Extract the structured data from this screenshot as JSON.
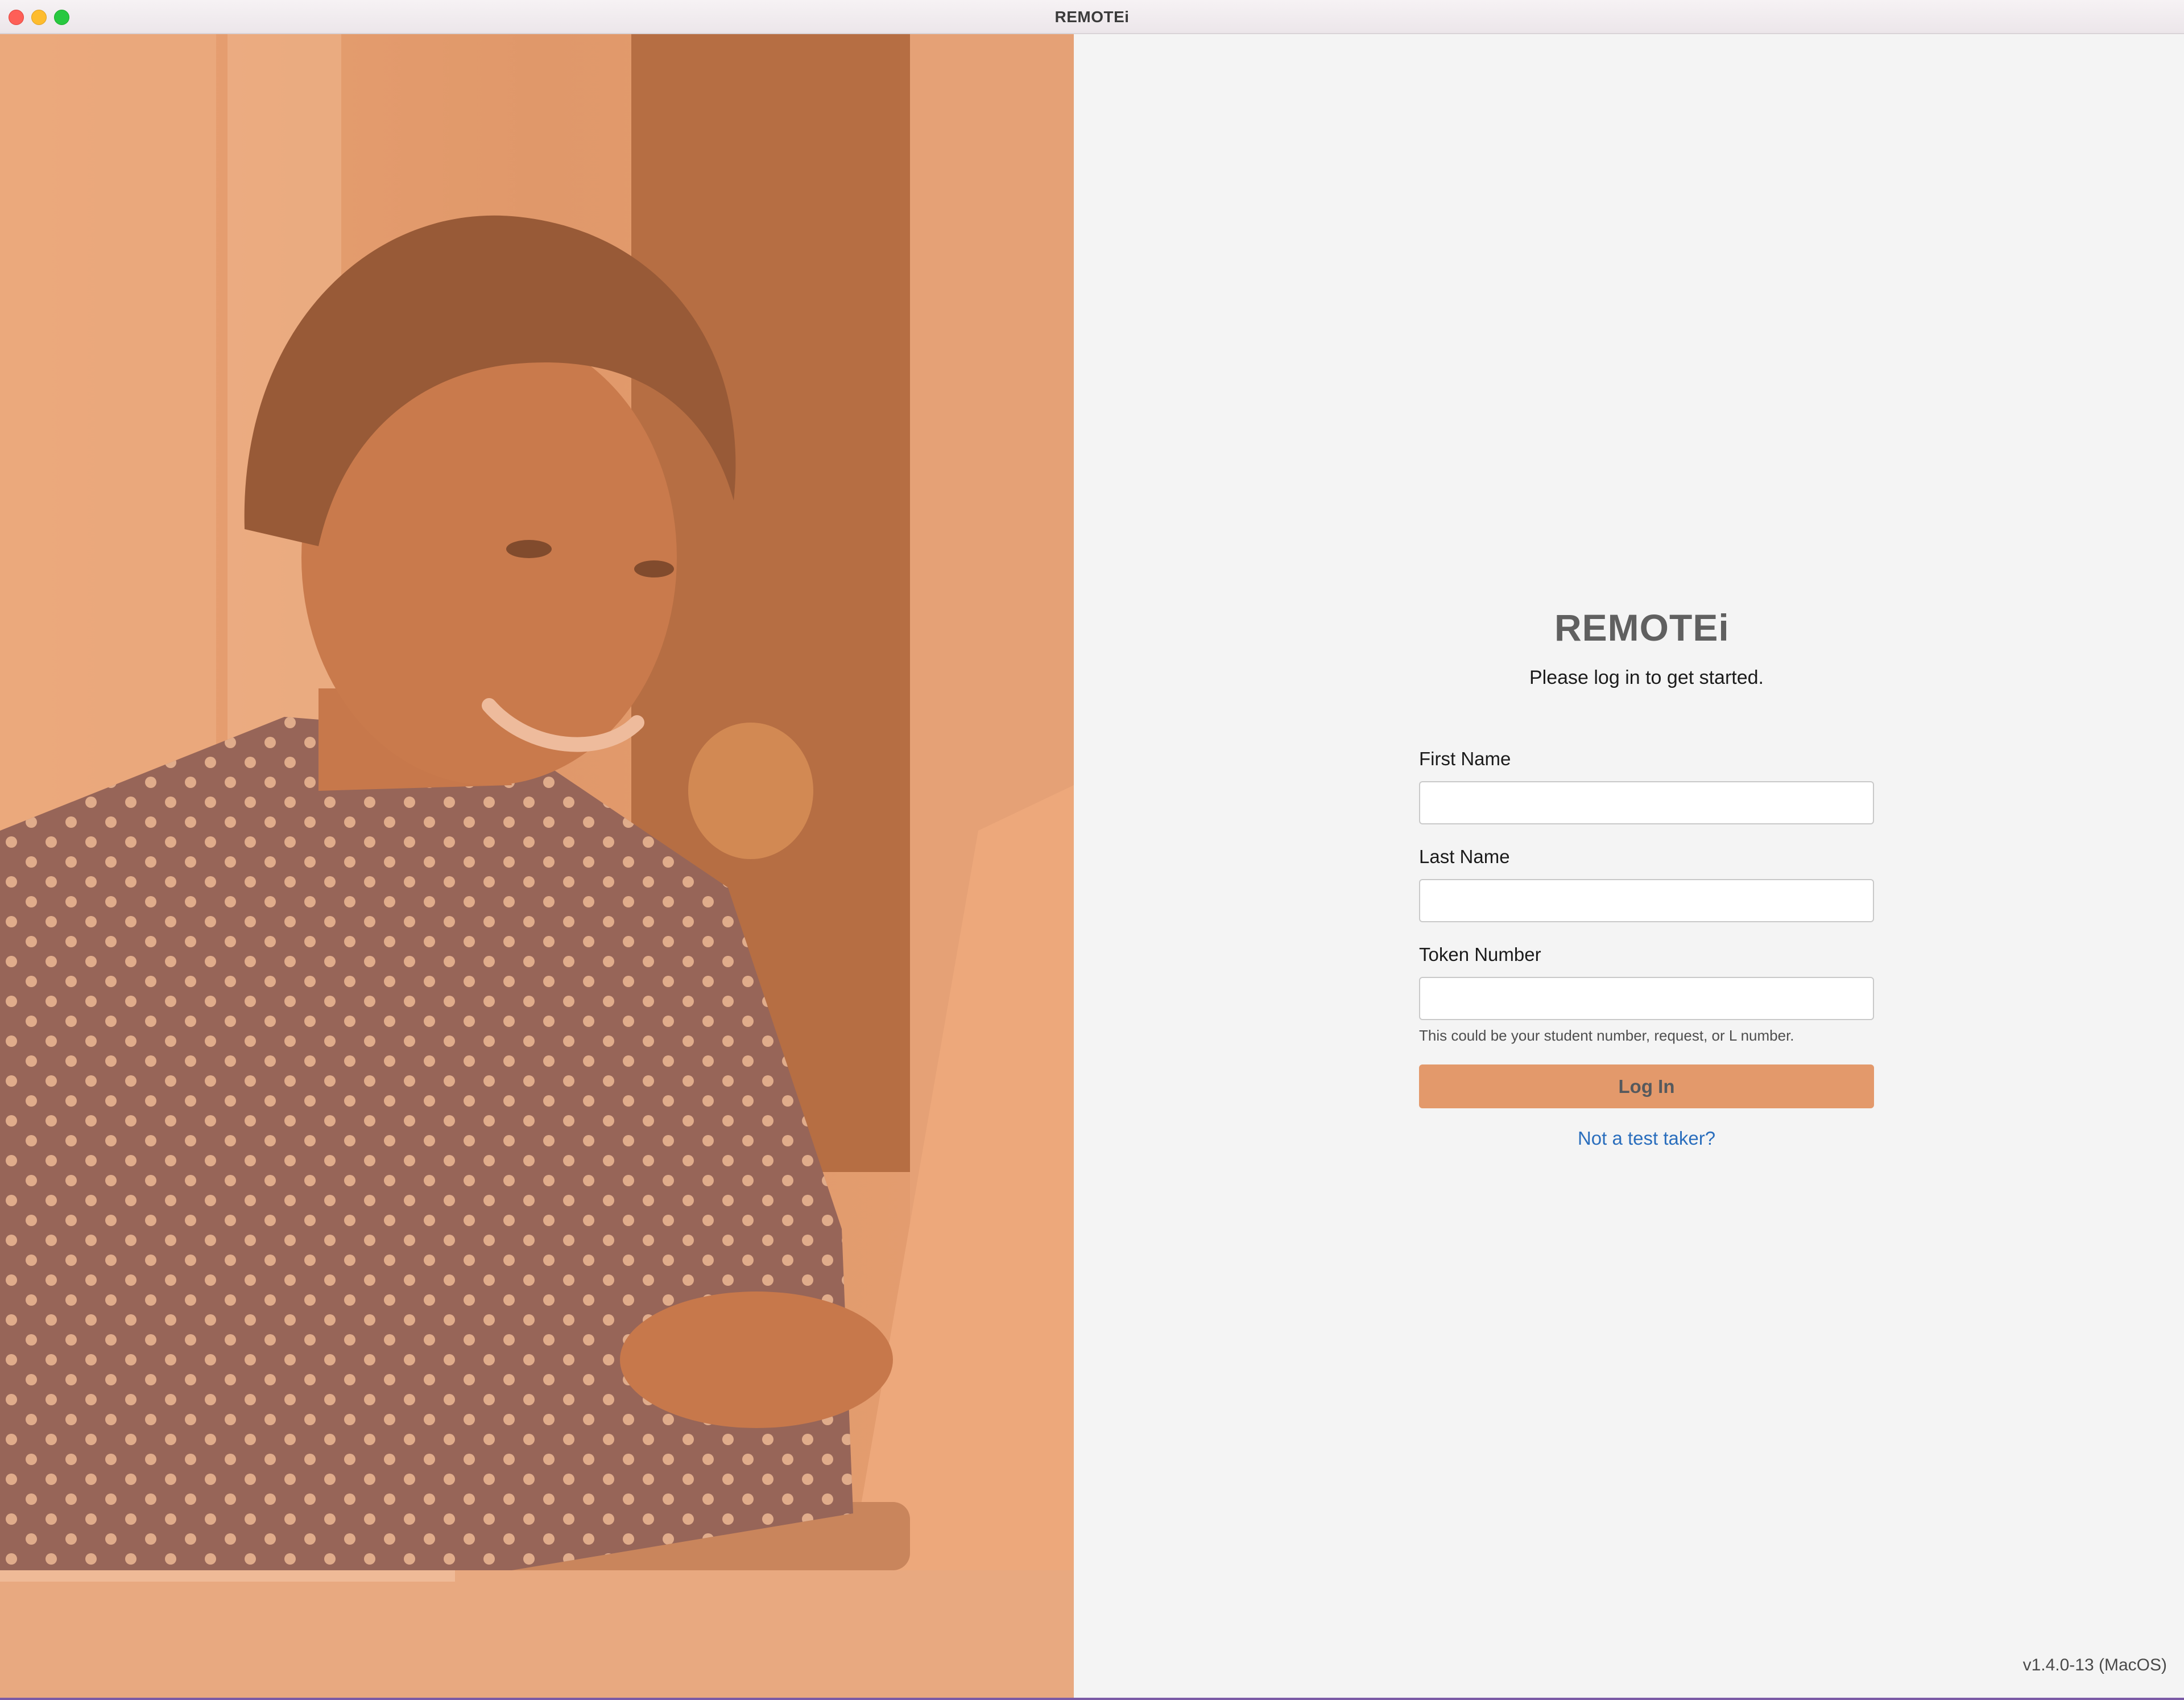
{
  "window": {
    "title": "REMOTEi"
  },
  "login": {
    "logo_text": "REMOTEi",
    "subtitle": "Please log in to get started.",
    "first_name": {
      "label": "First Name",
      "value": "",
      "placeholder": ""
    },
    "last_name": {
      "label": "Last Name",
      "value": "",
      "placeholder": ""
    },
    "token_number": {
      "label": "Token Number",
      "value": "",
      "placeholder": "",
      "hint": "This could be your student number, request, or L number."
    },
    "login_button_label": "Log In",
    "not_test_taker_link": "Not a test taker?"
  },
  "footer": {
    "version": "v1.4.0-13 (MacOS)"
  },
  "colors": {
    "accent_orange": "#e3996b",
    "link_blue": "#2a6ebd",
    "panel_bg": "#f4f4f4"
  },
  "icons": {
    "close": "traffic-light-close-icon",
    "minimize": "traffic-light-minimize-icon",
    "maximize": "traffic-light-maximize-icon"
  }
}
